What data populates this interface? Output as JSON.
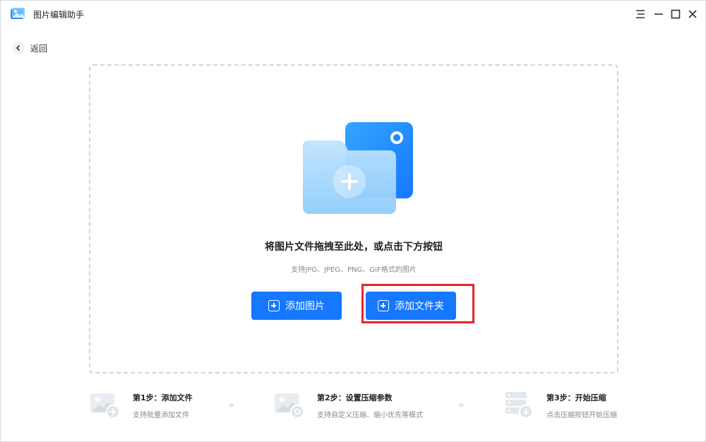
{
  "app": {
    "title": "图片编辑助手"
  },
  "window_controls": {
    "menu": "menu-icon",
    "minimize": "minimize-icon",
    "maximize": "maximize-icon",
    "close": "close-icon"
  },
  "nav": {
    "back_label": "返回"
  },
  "dropzone": {
    "title": "将图片文件拖拽至此处，或点击下方按钮",
    "subtitle": "支持JPG、JPEG、PNG、GIF格式的图片",
    "add_image_label": "添加图片",
    "add_folder_label": "添加文件夹"
  },
  "steps": [
    {
      "title": "第1步：添加文件",
      "desc": "支持批量添加文件",
      "icon": "image-add-icon"
    },
    {
      "title": "第2步：设置压缩参数",
      "desc": "支持自定义压缩、缩小优先等模式",
      "icon": "image-settings-icon"
    },
    {
      "title": "第3步：开始压缩",
      "desc": "点击压缩按钮开始压缩",
      "icon": "server-download-icon"
    }
  ],
  "colors": {
    "accent": "#1677ff",
    "highlight": "#e8232b",
    "border": "#cfd5dc"
  }
}
